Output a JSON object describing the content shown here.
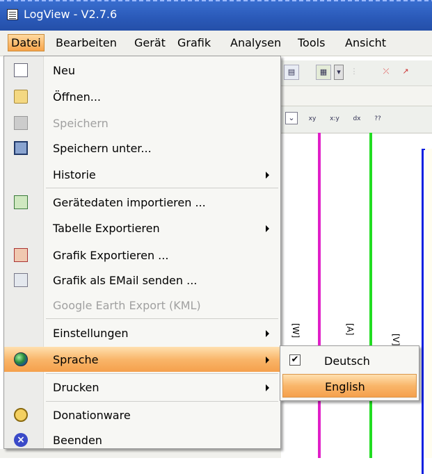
{
  "window": {
    "title": "LogView - V2.7.6"
  },
  "menubar": {
    "items": [
      "Datei",
      "Bearbeiten",
      "Gerät",
      "Grafik",
      "Analysen",
      "Tools",
      "Ansicht"
    ],
    "active": "Datei"
  },
  "datei_menu": {
    "items": [
      {
        "label": "Neu",
        "icon": "new-document-icon"
      },
      {
        "label": "Öffnen...",
        "icon": "open-folder-icon"
      },
      {
        "label": "Speichern",
        "icon": "save-disk-icon",
        "disabled": true
      },
      {
        "label": "Speichern unter...",
        "icon": "save-as-disk-icon"
      },
      {
        "label": "Historie",
        "submenu": true
      },
      {
        "label": "Gerätedaten importieren ...",
        "icon": "import-device-icon"
      },
      {
        "label": "Tabelle Exportieren",
        "submenu": true
      },
      {
        "label": "Grafik Exportieren ...",
        "icon": "export-graphic-icon"
      },
      {
        "label": "Grafik als EMail senden ...",
        "icon": "email-graphic-icon"
      },
      {
        "label": "Google Earth Export (KML)",
        "disabled": true
      },
      {
        "label": "Einstellungen",
        "submenu": true
      },
      {
        "label": "Sprache",
        "icon": "globe-icon",
        "submenu": true,
        "highlighted": true
      },
      {
        "label": "Drucken",
        "submenu": true
      },
      {
        "label": "Donationware",
        "icon": "coins-icon"
      },
      {
        "label": "Beenden",
        "icon": "exit-icon"
      }
    ]
  },
  "sprache_submenu": {
    "items": [
      {
        "label": "Deutsch",
        "checked": true
      },
      {
        "label": "English",
        "highlighted": true
      }
    ]
  },
  "chart_bg": {
    "axis_labels": [
      "[W]",
      "[A]",
      "[V]"
    ],
    "line_colors": [
      "#e020c8",
      "#22dd22",
      "#1020e0"
    ]
  }
}
